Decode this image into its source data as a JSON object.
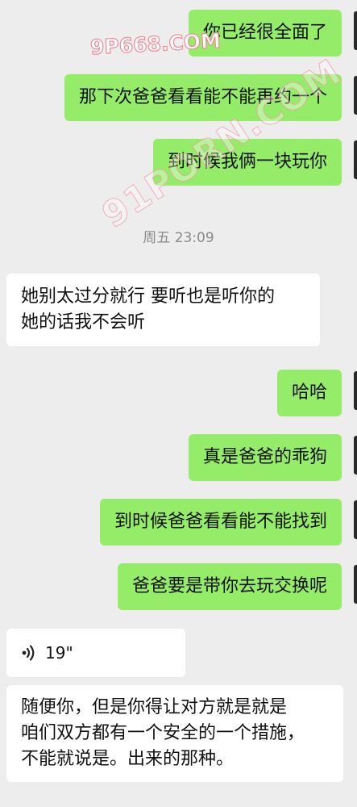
{
  "messages": [
    {
      "dir": "out",
      "text": "你已经很全面了"
    },
    {
      "dir": "out",
      "text": "那下次爸爸看看能不能再约一个"
    },
    {
      "dir": "out",
      "text": "到时候我俩一块玩你"
    },
    {
      "dir": "in",
      "lines": [
        "她别太过分就行  要听也是听你的",
        "她的话我不会听"
      ]
    },
    {
      "dir": "out",
      "text": "哈哈"
    },
    {
      "dir": "out",
      "text": "真是爸爸的乖狗"
    },
    {
      "dir": "out",
      "text": "到时候爸爸看看能不能找到"
    },
    {
      "dir": "out",
      "text": "爸爸要是带你去玩交换呢"
    },
    {
      "dir": "in",
      "type": "voice",
      "duration": "19\""
    },
    {
      "dir": "in",
      "lines": [
        "随便你，但是你得让对方就是就是",
        "咱们双方都有一个安全的一个措施，",
        "不能就说是。出来的那种。"
      ]
    }
  ],
  "timestamp": "周五 23:09",
  "watermarks": [
    "9P668.COM",
    "91PORN.COM"
  ],
  "colors": {
    "background": "#ededed",
    "outgoing_bubble": "#95ec69",
    "incoming_bubble": "#ffffff"
  }
}
